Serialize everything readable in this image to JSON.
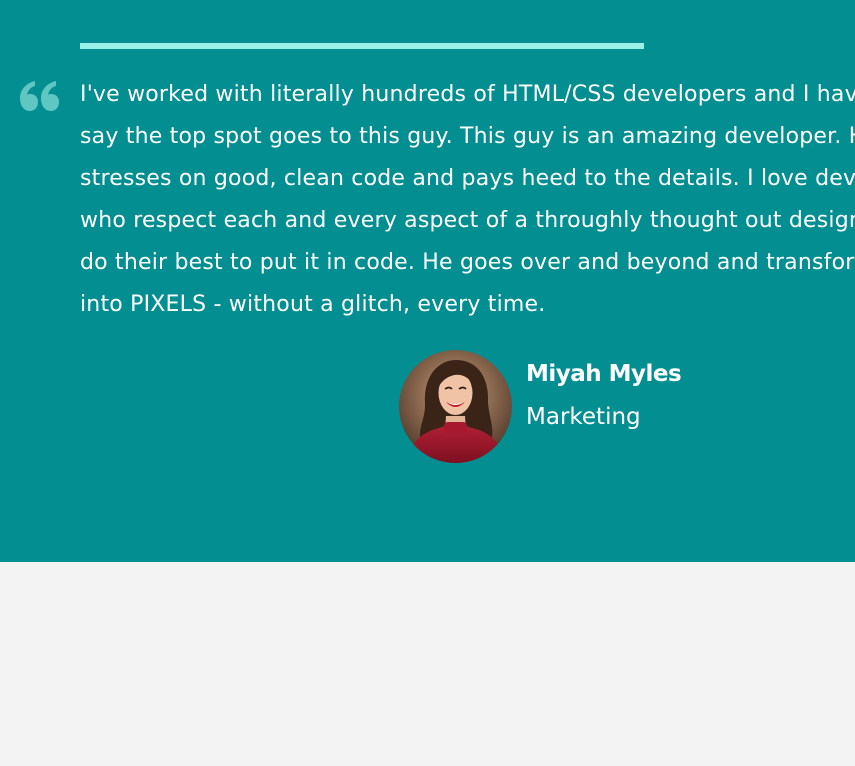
{
  "testimonial": {
    "quote_lines": [
      "I've worked with literally hundreds of HTML/CSS developers and I have to",
      "say the top spot goes to this guy. This guy is an amazing developer. He",
      "stresses on good, clean code and pays heed to the details. I love developers",
      "who respect each and every aspect of a throughly thought out design and",
      "do their best to put it in code. He goes over and beyond and transforms ART",
      "into PIXELS - without a glitch, every time."
    ],
    "author": {
      "name": "Miyah Myles",
      "role": "Marketing"
    }
  },
  "icons": {
    "quote": "quote-icon",
    "avatar": "avatar-photo"
  },
  "colors": {
    "background": "#038e91",
    "accent_bar": "#9cf0e8",
    "quote_mark": "#5fc6c2",
    "page": "#f3f3f3",
    "text": "#ffffff"
  }
}
